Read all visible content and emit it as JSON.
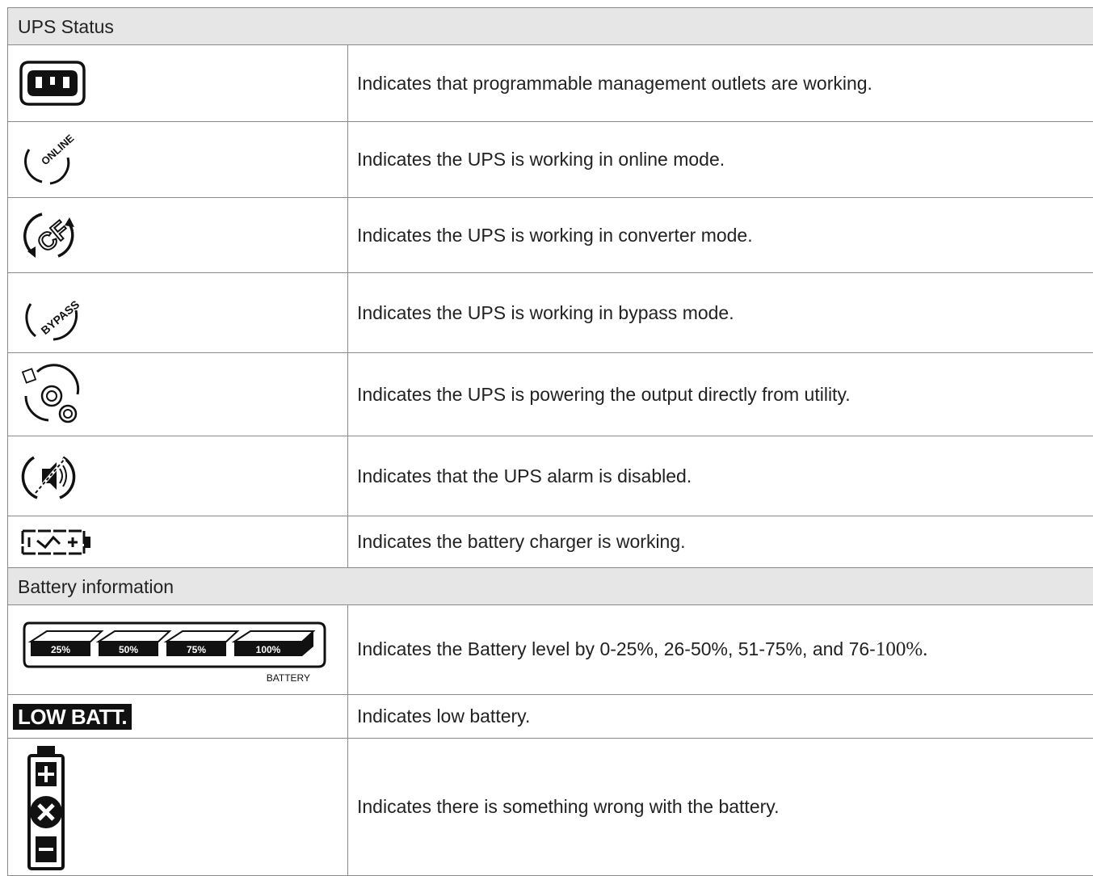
{
  "sections": {
    "ups_status": "UPS Status",
    "battery_information": "Battery information"
  },
  "rows": [
    {
      "icon": "outlet-icon",
      "text": "Indicates that programmable management outlets are working."
    },
    {
      "icon": "online-mode-icon",
      "icon_label": "ONLINE",
      "text": "Indicates the UPS is working in online mode."
    },
    {
      "icon": "converter-mode-icon",
      "icon_label": "CF",
      "text": "Indicates the UPS is working in converter mode."
    },
    {
      "icon": "bypass-mode-icon",
      "icon_label": "BYPASS",
      "text": "Indicates the UPS is working in bypass mode."
    },
    {
      "icon": "utility-direct-icon",
      "text": "Indicates the UPS is powering the output directly from utility."
    },
    {
      "icon": "alarm-disabled-icon",
      "text": "Indicates that the UPS alarm is disabled."
    },
    {
      "icon": "battery-charger-icon",
      "text": "Indicates the battery charger is working."
    }
  ],
  "battery_rows": [
    {
      "icon": "battery-level-icon",
      "levels": [
        "25%",
        "50%",
        "75%",
        "100%"
      ],
      "icon_caption": "BATTERY",
      "text_main": "Indicates the Battery level by 0-25%, 26-50%, 51-75%, and 76-",
      "text_tail": "100%."
    },
    {
      "icon": "low-battery-icon",
      "icon_label": "LOW BATT.",
      "text": "Indicates low battery."
    },
    {
      "icon": "battery-fault-icon",
      "text": "Indicates there is something wrong with the battery."
    }
  ]
}
